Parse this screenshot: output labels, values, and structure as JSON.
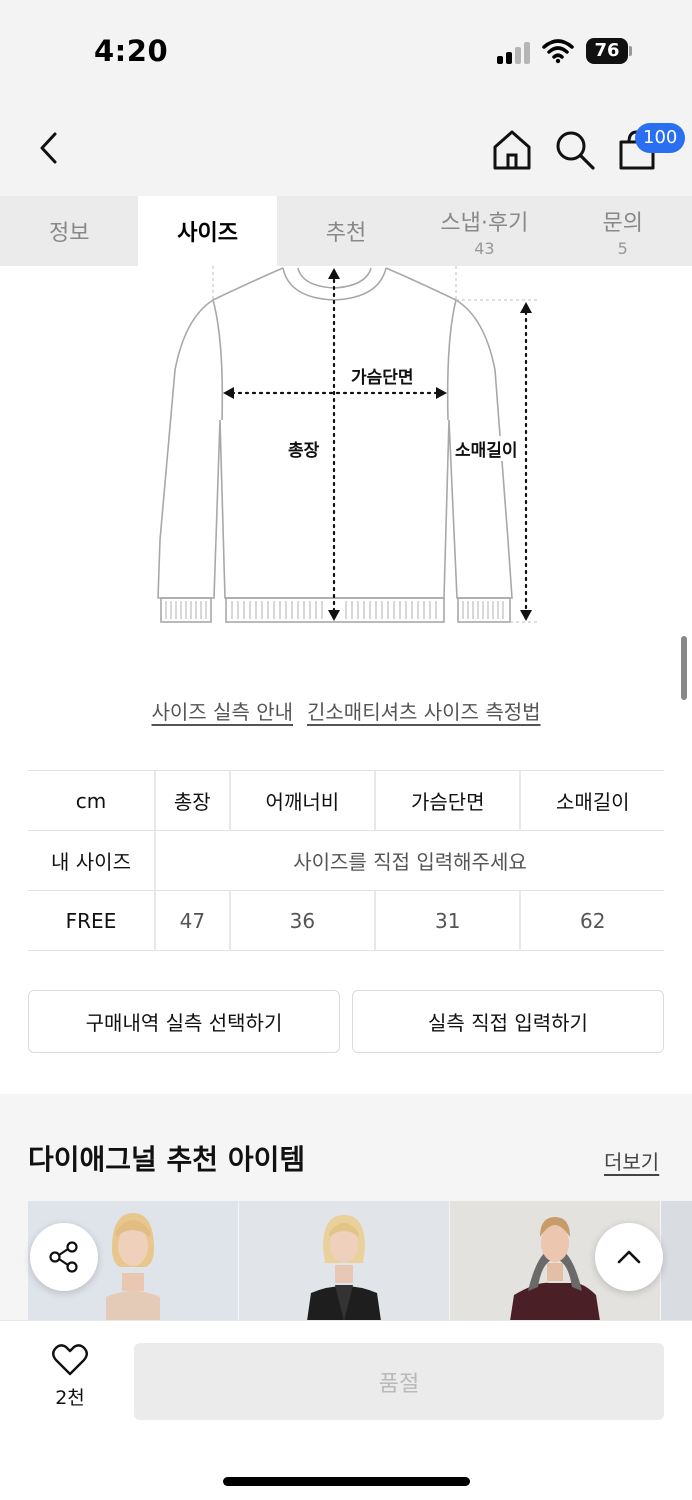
{
  "status_bar": {
    "time": "4:20",
    "battery": "76"
  },
  "header": {
    "cart_badge": "100"
  },
  "tabs": [
    {
      "label": "정보",
      "count": ""
    },
    {
      "label": "사이즈",
      "count": ""
    },
    {
      "label": "추천",
      "count": ""
    },
    {
      "label": "스냅·후기",
      "count": "43"
    },
    {
      "label": "문의",
      "count": "5"
    }
  ],
  "active_tab": "사이즈",
  "diagram": {
    "chest_label": "가슴단면",
    "length_label": "총장",
    "sleeve_label": "소매길이"
  },
  "guide_links": {
    "measure_guide": "사이즈 실측 안내",
    "method": "긴소매티셔츠 사이즈 측정법"
  },
  "size_table": {
    "headers": [
      "cm",
      "총장",
      "어깨너비",
      "가슴단면",
      "소매길이"
    ],
    "my_size_label": "내 사이즈",
    "my_size_placeholder": "사이즈를 직접 입력해주세요",
    "rows": [
      {
        "size": "FREE",
        "values": [
          "47",
          "36",
          "31",
          "62"
        ]
      }
    ]
  },
  "actions": {
    "select_from_purchases": "구매내역 실측 선택하기",
    "enter_directly": "실측 직접 입력하기"
  },
  "recommend": {
    "title": "다이애그널 추천 아이템",
    "more": "더보기"
  },
  "bottom_bar": {
    "like_count": "2천",
    "buy_label": "품절"
  },
  "icons": [
    "back-icon",
    "home-icon",
    "search-icon",
    "cart-icon",
    "share-icon",
    "chevron-up-icon",
    "heart-icon"
  ]
}
